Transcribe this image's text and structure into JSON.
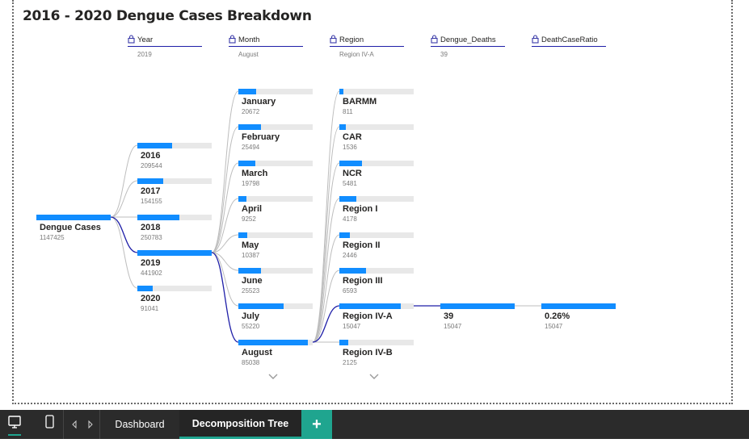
{
  "title": "2016 - 2020 Dengue Cases Breakdown",
  "headers": [
    {
      "name": "Year",
      "value": "2019"
    },
    {
      "name": "Month",
      "value": "August"
    },
    {
      "name": "Region",
      "value": "Region IV-A"
    },
    {
      "name": "Dengue_Deaths",
      "value": "39"
    },
    {
      "name": "DeathCaseRatio",
      "value": ""
    }
  ],
  "root": {
    "label": "Dengue Cases",
    "value": "1147425",
    "fraction": 1.0
  },
  "years": [
    {
      "label": "2016",
      "value": "209544",
      "fraction": 0.47
    },
    {
      "label": "2017",
      "value": "154155",
      "fraction": 0.35
    },
    {
      "label": "2018",
      "value": "250783",
      "fraction": 0.57
    },
    {
      "label": "2019",
      "value": "441902",
      "fraction": 1.0
    },
    {
      "label": "2020",
      "value": "91041",
      "fraction": 0.21
    }
  ],
  "months": [
    {
      "label": "January",
      "value": "20672",
      "fraction": 0.24
    },
    {
      "label": "February",
      "value": "25494",
      "fraction": 0.3
    },
    {
      "label": "March",
      "value": "19798",
      "fraction": 0.23
    },
    {
      "label": "April",
      "value": "9252",
      "fraction": 0.11
    },
    {
      "label": "May",
      "value": "10387",
      "fraction": 0.12
    },
    {
      "label": "June",
      "value": "25523",
      "fraction": 0.3
    },
    {
      "label": "July",
      "value": "55220",
      "fraction": 0.61
    },
    {
      "label": "August",
      "value": "85038",
      "fraction": 0.94
    }
  ],
  "regions": [
    {
      "label": "BARMM",
      "value": "811",
      "fraction": 0.05
    },
    {
      "label": "CAR",
      "value": "1536",
      "fraction": 0.09
    },
    {
      "label": "NCR",
      "value": "5481",
      "fraction": 0.3
    },
    {
      "label": "Region I",
      "value": "4178",
      "fraction": 0.23
    },
    {
      "label": "Region II",
      "value": "2446",
      "fraction": 0.14
    },
    {
      "label": "Region III",
      "value": "6593",
      "fraction": 0.36
    },
    {
      "label": "Region IV-A",
      "value": "15047",
      "fraction": 0.83
    },
    {
      "label": "Region IV-B",
      "value": "2125",
      "fraction": 0.12
    }
  ],
  "deaths_node": {
    "label": "39",
    "value": "15047",
    "fraction": 1.0
  },
  "ratio_node": {
    "label": "0.26%",
    "value": "15047",
    "fraction": 1.0
  },
  "tabs": {
    "dashboard": "Dashboard",
    "decomposition": "Decomposition Tree",
    "add": "+"
  },
  "colors": {
    "bar": "#118DFF",
    "track": "#E8E8E8",
    "active_path": "#1F1FA8",
    "inactive_path": "#BDBDBD",
    "tab_accent": "#1FA58F"
  },
  "icons": [
    "desktop-view-icon",
    "mobile-view-icon",
    "prev-page-icon",
    "next-page-icon",
    "lock-icon",
    "chevron-down-icon"
  ]
}
